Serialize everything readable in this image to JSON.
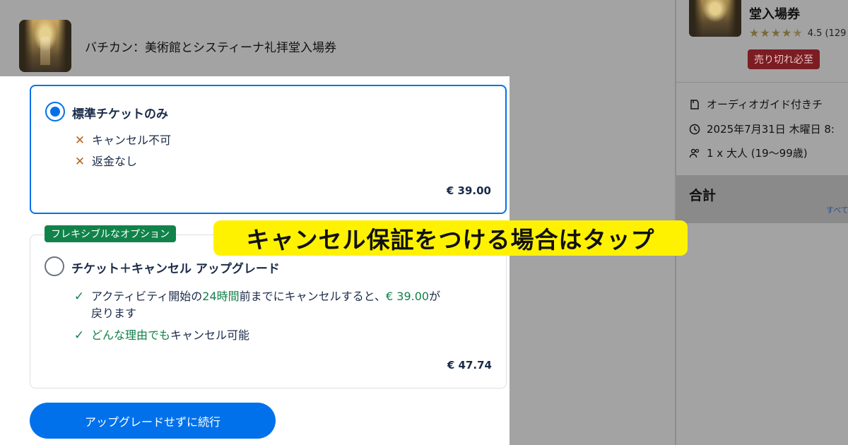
{
  "header": {
    "title": "バチカン：美術館とシスティーナ礼拝堂入場券"
  },
  "summary": {
    "title": "堂入場券",
    "rating_stars": "★★★★★",
    "rating_text": "4.5 (129",
    "badge": "売り切れ必至",
    "details": [
      "オーディオガイド付きチ",
      "2025年7月31日 木曜日 8:",
      "1 x 大人 (19〜99歳)"
    ],
    "total_label": "合計",
    "total_note": "すべて"
  },
  "options": [
    {
      "title": "標準チケットのみ",
      "selected": true,
      "features": [
        {
          "icon": "x-icon",
          "text": "キャンセル不可"
        },
        {
          "icon": "x-icon",
          "text": "返金なし"
        }
      ],
      "price": "€ 39.00"
    },
    {
      "badge": "フレキシブルなオプション",
      "title": "チケット＋キャンセル アップグレード",
      "selected": false,
      "features": [
        {
          "icon": "check-icon",
          "text_a": "アクティビティ開始の",
          "text_b": "24時間",
          "text_c": "前までにキャンセルすると、",
          "text_d": "€ 39.00",
          "text_e": "が",
          "text_f": "戻ります"
        },
        {
          "icon": "check-icon",
          "text_a": "どんな理由でも",
          "text_b": "キャンセル可能"
        }
      ],
      "price": "€ 47.74"
    }
  ],
  "continue_button": "アップグレードせずに続行",
  "annotation": "キャンセル保証をつける場合はタップ",
  "colors": {
    "accent": "#0071eb",
    "green": "#13804a",
    "callout": "#fff200",
    "x_mark": "#b5651d"
  }
}
